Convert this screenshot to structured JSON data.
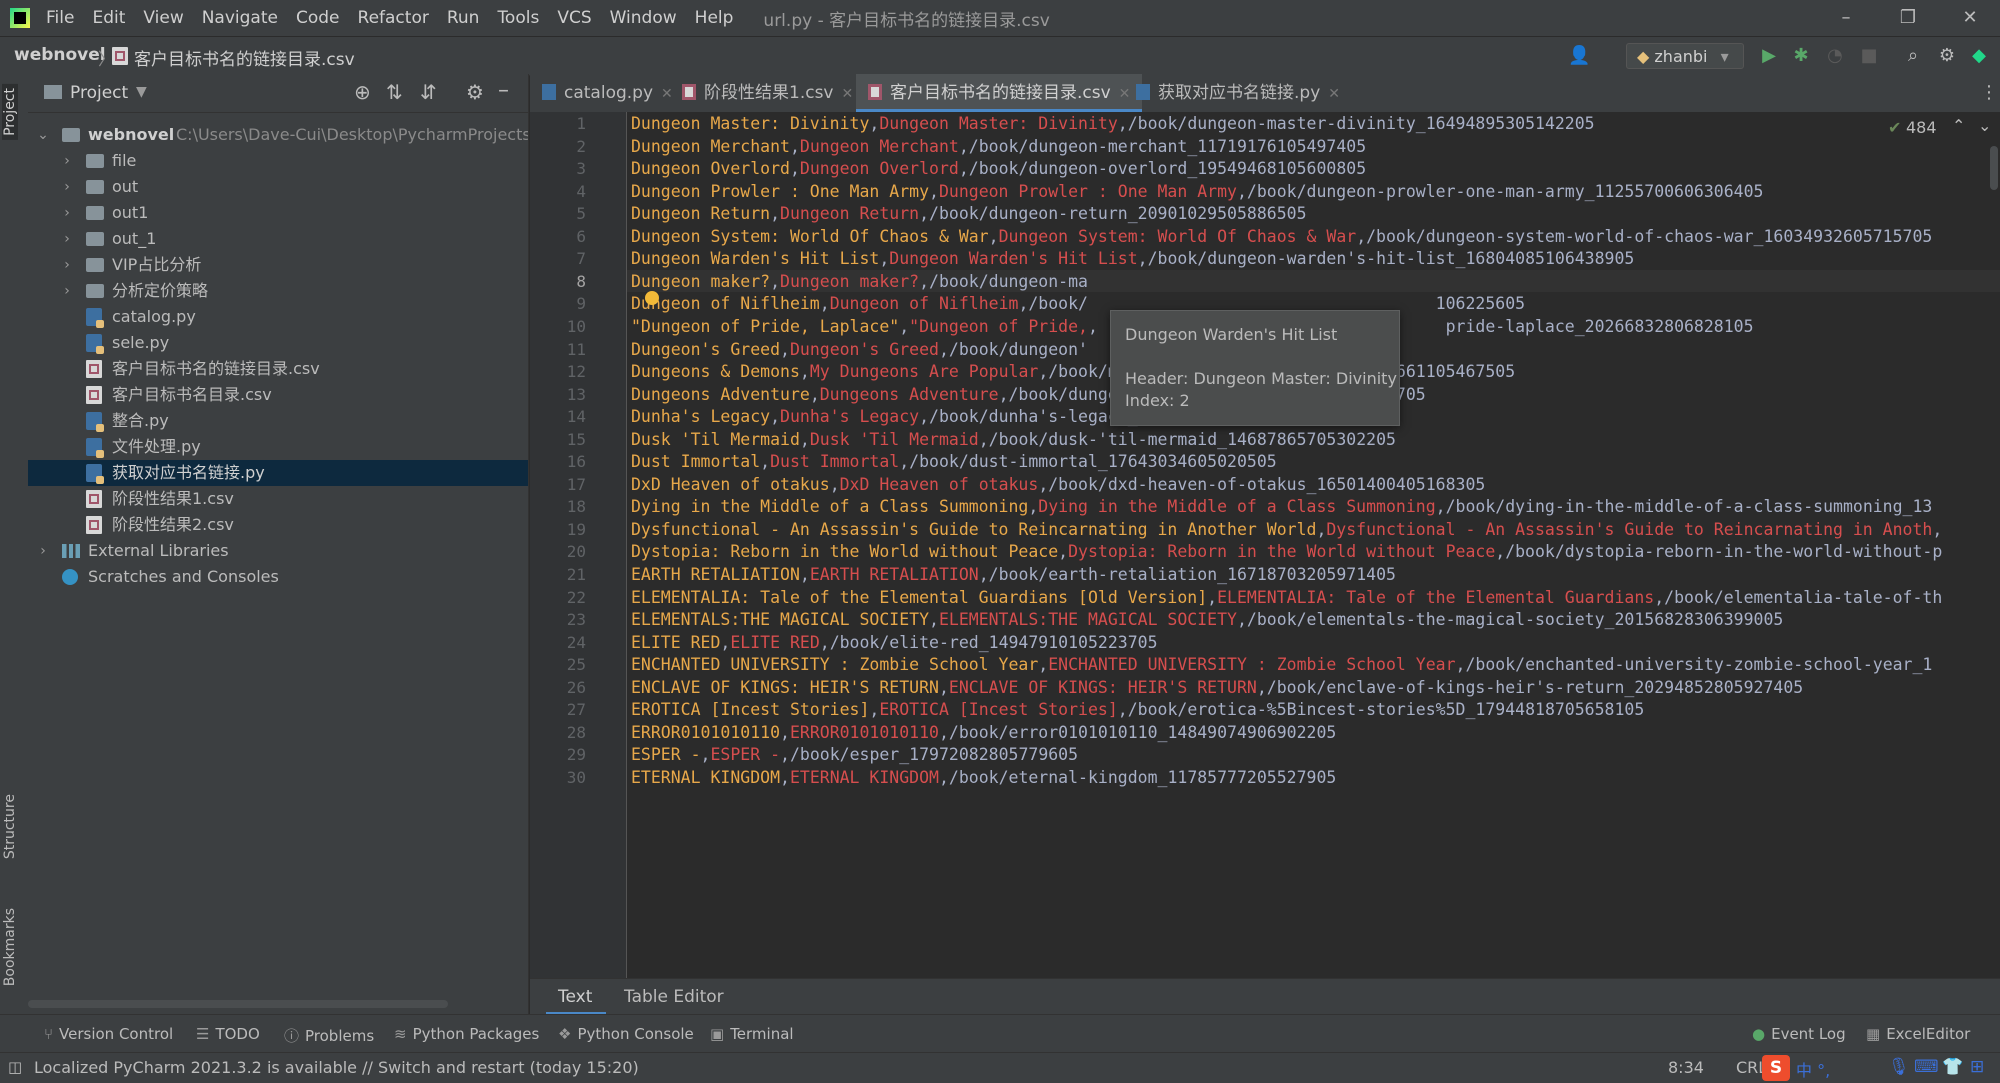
{
  "app": {
    "window_title": "url.py - 客户目标书名的链接目录.csv",
    "menu": [
      "File",
      "Edit",
      "View",
      "Navigate",
      "Code",
      "Refactor",
      "Run",
      "Tools",
      "VCS",
      "Window",
      "Help"
    ]
  },
  "navbar": {
    "project": "webnovel",
    "separator": "〉",
    "file": "客户目标书名的链接目录.csv",
    "run_config": "zhanbi"
  },
  "side_tabs": {
    "project": "Project",
    "structure": "Structure",
    "bookmarks": "Bookmarks"
  },
  "project_panel": {
    "title": "Project",
    "root": {
      "name": "webnovel",
      "path": "C:\\Users\\Dave-Cui\\Desktop\\PycharmProjects\\爬"
    },
    "items": [
      {
        "label": "file",
        "type": "folder"
      },
      {
        "label": "out",
        "type": "folder"
      },
      {
        "label": "out1",
        "type": "folder"
      },
      {
        "label": "out_1",
        "type": "folder"
      },
      {
        "label": "VIP占比分析",
        "type": "folder"
      },
      {
        "label": "分析定价策略",
        "type": "folder"
      },
      {
        "label": "catalog.py",
        "type": "py"
      },
      {
        "label": "sele.py",
        "type": "py"
      },
      {
        "label": "客户目标书名的链接目录.csv",
        "type": "csv"
      },
      {
        "label": "客户目标书名目录.csv",
        "type": "csv"
      },
      {
        "label": "整合.py",
        "type": "py"
      },
      {
        "label": "文件处理.py",
        "type": "py"
      },
      {
        "label": "获取对应书名链接.py",
        "type": "py"
      },
      {
        "label": "阶段性结果1.csv",
        "type": "csv"
      },
      {
        "label": "阶段性结果2.csv",
        "type": "csv"
      }
    ],
    "external_libraries": "External Libraries",
    "scratches": "Scratches and Consoles"
  },
  "editor_tabs": [
    {
      "label": "catalog.py",
      "type": "py"
    },
    {
      "label": "阶段性结果1.csv",
      "type": "csv"
    },
    {
      "label": "客户目标书名的链接目录.csv",
      "type": "csv"
    },
    {
      "label": "获取对应书名链接.py",
      "type": "py"
    }
  ],
  "inspections": {
    "count": "484"
  },
  "current_line": 8,
  "lines": [
    [
      "Dungeon Master: Divinity",
      "Dungeon Master: Divinity",
      "/book/dungeon-master-divinity_16494895305142205"
    ],
    [
      "Dungeon Merchant",
      "Dungeon Merchant",
      "/book/dungeon-merchant_11719176105497405"
    ],
    [
      "Dungeon Overlord",
      "Dungeon Overlord",
      "/book/dungeon-overlord_19549468105600805"
    ],
    [
      "Dungeon Prowler : One Man Army",
      "Dungeon Prowler : One Man Army",
      "/book/dungeon-prowler-one-man-army_11255700606306405"
    ],
    [
      "Dungeon Return",
      "Dungeon Return",
      "/book/dungeon-return_20901029505886505"
    ],
    [
      "Dungeon System: World Of Chaos & War",
      "Dungeon System: World Of Chaos & War",
      "/book/dungeon-system-world-of-chaos-war_16034932605715705"
    ],
    [
      "Dungeon Warden's Hit List",
      "Dungeon Warden's Hit List",
      "/book/dungeon-warden's-hit-list_16804085106438905"
    ],
    [
      "Dungeon maker?",
      "Dungeon maker?",
      "/book/dungeon-ma"
    ],
    [
      "Dungeon of Niflheim",
      "Dungeon of Niflheim",
      "/book/                                   106225605"
    ],
    [
      "\"Dungeon of Pride, Laplace\"",
      "\"Dungeon of Pride,",
      "                                   pride-laplace_20266832806828105"
    ],
    [
      "Dungeon's Greed",
      "Dungeon's Greed",
      "/book/dungeon'"
    ],
    [
      "Dungeons & Demons",
      "My Dungeons Are Popular",
      "/book/my-dungeons-are-popular_19852661105467505"
    ],
    [
      "Dungeons Adventure",
      "Dungeons Adventure",
      "/book/dungeons-adventure_20810399106219705"
    ],
    [
      "Dunha's Legacy",
      "Dunha's Legacy",
      "/book/dunha's-legacy_16117953106049805"
    ],
    [
      "Dusk 'Til Mermaid",
      "Dusk 'Til Mermaid",
      "/book/dusk-'til-mermaid_14687865705302205"
    ],
    [
      "Dust Immortal",
      "Dust Immortal",
      "/book/dust-immortal_17643034605020505"
    ],
    [
      "DxD Heaven of otakus",
      "DxD Heaven of otakus",
      "/book/dxd-heaven-of-otakus_16501400405168305"
    ],
    [
      "Dying in the Middle of a Class Summoning",
      "Dying in the Middle of a Class Summoning",
      "/book/dying-in-the-middle-of-a-class-summoning_13"
    ],
    [
      "Dysfunctional - An Assassin's Guide to Reincarnating in Another World",
      "Dysfunctional - An Assassin's Guide to Reincarnating in Anoth",
      ""
    ],
    [
      "Dystopia: Reborn in the World without Peace",
      "Dystopia: Reborn in the World without Peace",
      "/book/dystopia-reborn-in-the-world-without-p"
    ],
    [
      "EARTH RETALIATION",
      "EARTH RETALIATION",
      "/book/earth-retaliation_16718703205971405"
    ],
    [
      "ELEMENTALIA: Tale of the Elemental Guardians [Old Version]",
      "ELEMENTALIA: Tale of the Elemental Guardians",
      "/book/elementalia-tale-of-th"
    ],
    [
      "ELEMENTALS:THE MAGICAL SOCIETY",
      "ELEMENTALS:THE MAGICAL SOCIETY",
      "/book/elementals-the-magical-society_20156828306399005"
    ],
    [
      "ELITE RED",
      "ELITE RED",
      "/book/elite-red_14947910105223705"
    ],
    [
      "ENCHANTED UNIVERSITY : Zombie School Year",
      "ENCHANTED UNIVERSITY : Zombie School Year",
      "/book/enchanted-university-zombie-school-year_1"
    ],
    [
      "ENCLAVE OF KINGS: HEIR'S RETURN",
      "ENCLAVE OF KINGS: HEIR'S RETURN",
      "/book/enclave-of-kings-heir's-return_20294852805927405"
    ],
    [
      "EROTICA [Incest Stories]",
      "EROTICA [Incest Stories]",
      "/book/erotica-%5Bincest-stories%5D_17944818705658105"
    ],
    [
      "ERROR0101010110",
      "ERROR0101010110",
      "/book/error0101010110_14849074906902205"
    ],
    [
      "ESPER -",
      "ESPER -",
      "/book/esper_17972082805779605"
    ],
    [
      "ETERNAL KINGDOM",
      "ETERNAL KINGDOM",
      "/book/eternal-kingdom_11785777205527905"
    ]
  ],
  "tooltip": {
    "title": "Dungeon Warden's Hit List",
    "header": "Header: Dungeon Master: Divinity",
    "index": "Index: 2"
  },
  "bottom_editor_tabs": [
    "Text",
    "Table Editor"
  ],
  "tool_windows": [
    "Version Control",
    "TODO",
    "Problems",
    "Python Packages",
    "Python Console",
    "Terminal"
  ],
  "tool_windows_right": [
    "Event Log",
    "ExcelEditor"
  ],
  "status": {
    "message": "Localized PyCharm 2021.3.2 is available // Switch and restart (today 15:20)",
    "caret": "8:34",
    "line_separator": "CRLF"
  },
  "ime": {
    "chars": "中 °, "
  },
  "colors": {
    "accent": "#4a88c7",
    "col1": "#e8a84a",
    "col2": "#d64e4e",
    "col3": "#a8b0c7"
  }
}
